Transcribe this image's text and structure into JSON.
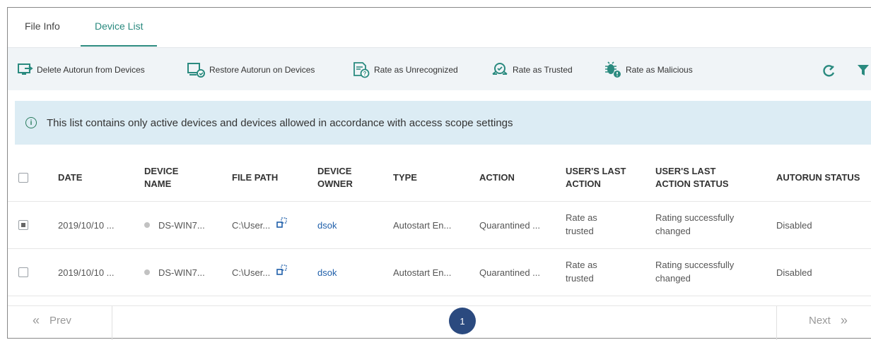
{
  "tabs": [
    {
      "label": "File Info"
    },
    {
      "label": "Device List"
    }
  ],
  "toolbar": {
    "delete_label": "Delete Autorun from Devices",
    "restore_label": "Restore Autorun on Devices",
    "unrecognized_label": "Rate as Unrecognized",
    "trusted_label": "Rate as Trusted",
    "malicious_label": "Rate as Malicious"
  },
  "info": {
    "text": "This list contains only active devices and devices allowed in accordance with access scope settings"
  },
  "table": {
    "headers": {
      "date": "DATE",
      "device_name_1": "DEVICE",
      "device_name_2": "NAME",
      "file_path": "FILE PATH",
      "device_owner_1": "DEVICE",
      "device_owner_2": "OWNER",
      "type": "TYPE",
      "action": "ACTION",
      "last_action_1": "USER'S LAST",
      "last_action_2": "ACTION",
      "last_status_1": "USER'S LAST",
      "last_status_2": "ACTION STATUS",
      "autorun_status": "AUTORUN STATUS"
    },
    "rows": [
      {
        "checked": true,
        "date": "2019/10/10 ...",
        "device_name": "DS-WIN7...",
        "file_path": "C:\\User...",
        "owner": "dsok",
        "type": "Autostart En...",
        "action": "Quarantined ...",
        "last_action_1": "Rate as",
        "last_action_2": "trusted",
        "last_status_1": "Rating successfully",
        "last_status_2": "changed",
        "autorun_status": "Disabled"
      },
      {
        "checked": false,
        "date": "2019/10/10 ...",
        "device_name": "DS-WIN7...",
        "file_path": "C:\\User...",
        "owner": "dsok",
        "type": "Autostart En...",
        "action": "Quarantined ...",
        "last_action_1": "Rate as",
        "last_action_2": "trusted",
        "last_status_1": "Rating successfully",
        "last_status_2": "changed",
        "autorun_status": "Disabled"
      }
    ]
  },
  "pager": {
    "prev_label": "Prev",
    "next_label": "Next",
    "current_page": "1",
    "prev_icon": "«",
    "next_icon": "»"
  },
  "info_icon": "i",
  "colors": {
    "accent": "#2a8a7f",
    "toolbar_bg": "#f0f4f7",
    "info_bg": "#dcecf4",
    "link": "#1f5faa",
    "page_active": "#2b4a7f"
  }
}
